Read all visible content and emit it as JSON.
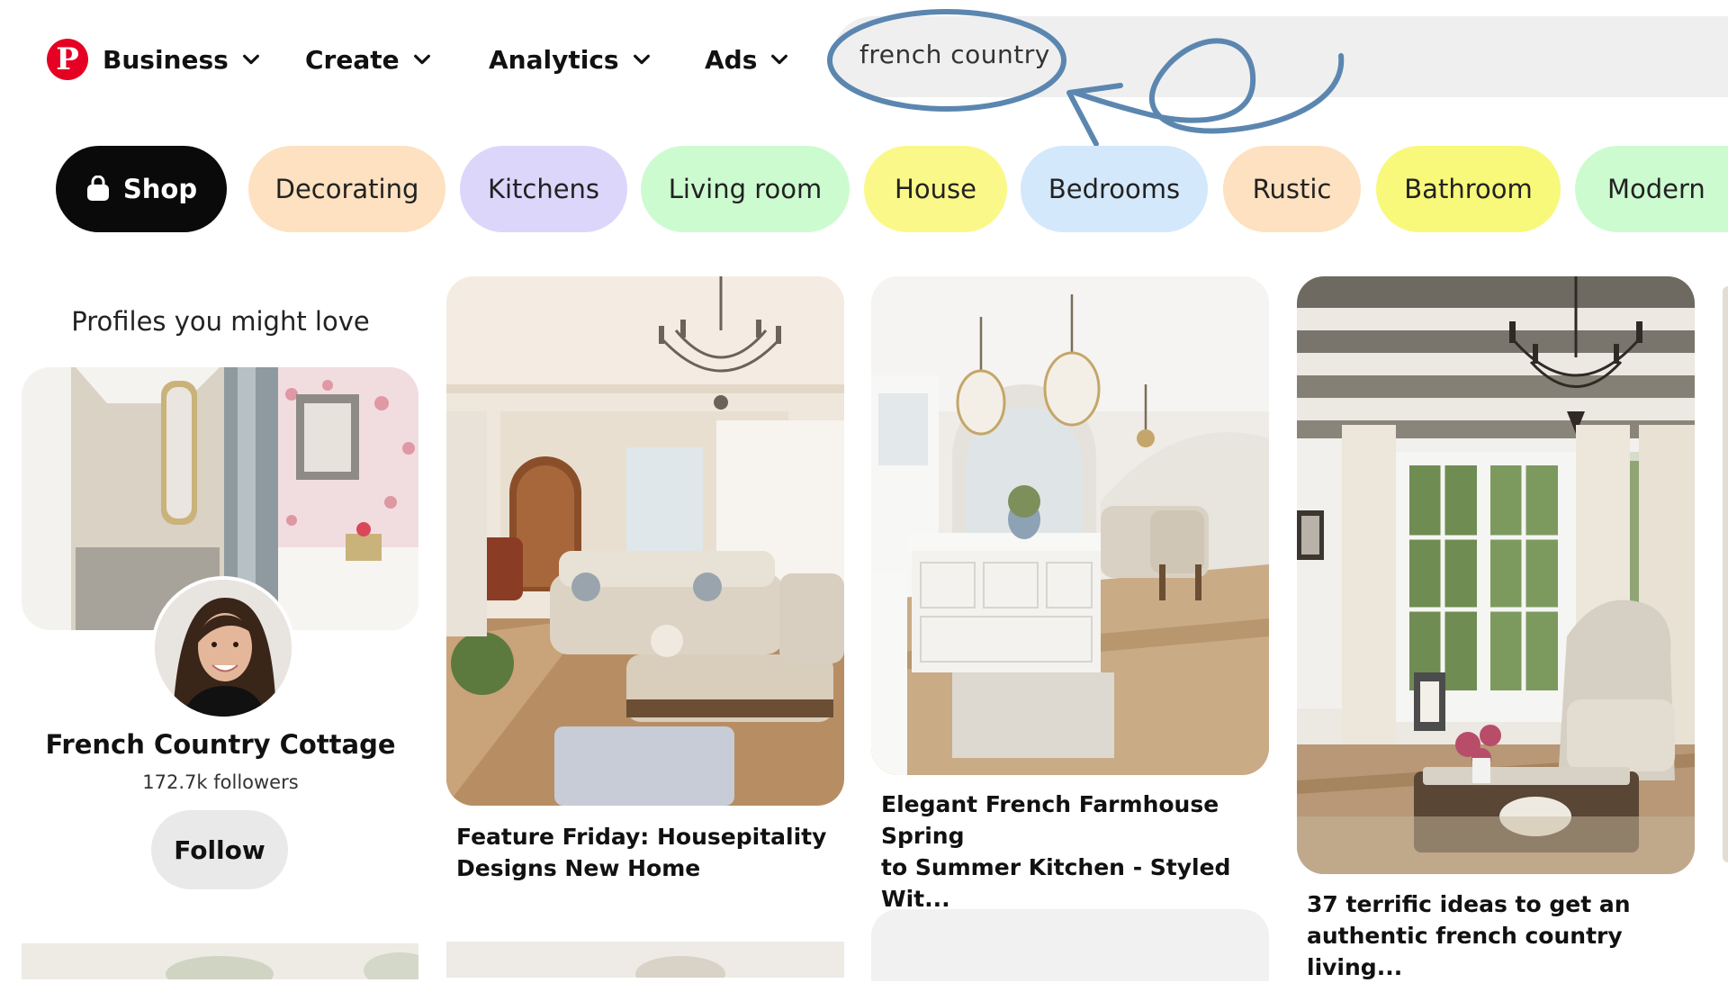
{
  "nav": {
    "logo_letter": "P",
    "business_label": "Business",
    "create_label": "Create",
    "analytics_label": "Analytics",
    "ads_label": "Ads",
    "search_value": "french country"
  },
  "chips": [
    {
      "label": "Shop",
      "color": "#0a0a0a"
    },
    {
      "label": "Decorating",
      "color": "#fde1c0"
    },
    {
      "label": "Kitchens",
      "color": "#dcd6fb"
    },
    {
      "label": "Living room",
      "color": "#cdfbd0"
    },
    {
      "label": "House",
      "color": "#fbf88a"
    },
    {
      "label": "Bedrooms",
      "color": "#d4e8fb"
    },
    {
      "label": "Rustic",
      "color": "#fde1c0"
    },
    {
      "label": "Bathroom",
      "color": "#f8f87a"
    },
    {
      "label": "Modern",
      "color": "#cdfbd0"
    }
  ],
  "profiles": {
    "heading": "Profiles you might love",
    "name": "French Country Cottage",
    "followers": "172.7k followers",
    "follow_label": "Follow"
  },
  "pins": [
    {
      "title_line1": "Feature Friday: Housepitality",
      "title_line2": "Designs New Home"
    },
    {
      "title_line1": "Elegant French Farmhouse Spring",
      "title_line2": "to Summer Kitchen - Styled Wit..."
    },
    {
      "title_line1": "37 terrific ideas to get an",
      "title_line2": "authentic french country living..."
    }
  ],
  "colors": {
    "brand_red": "#e60023",
    "annotation_blue": "#5b86b0"
  }
}
